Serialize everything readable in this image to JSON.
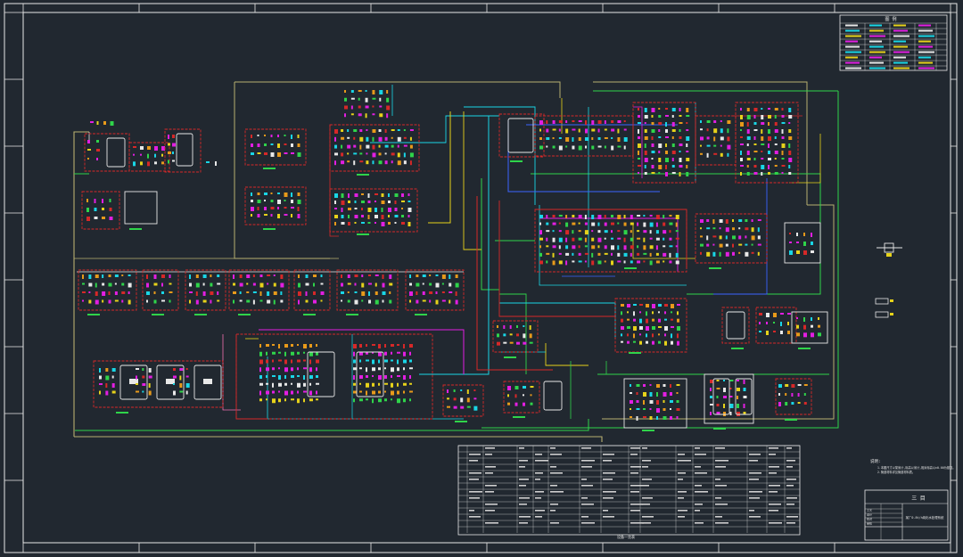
{
  "canvas": {
    "background": "#212830",
    "frame_color": "#e8e8e8"
  },
  "colors": {
    "red": "#d62828",
    "yellow": "#e6d21a",
    "green": "#2fd44a",
    "cyan": "#19d6e6",
    "blue": "#3a64ff",
    "magenta": "#e21ee2",
    "white": "#e8e8e8",
    "orange": "#e89a1a",
    "olive": "#b8b070",
    "pink": "#f06fb0",
    "purple": "#9b4dff"
  },
  "title_block": {
    "company": "三 目",
    "drawing_title": "某厂0.8t/h纯化水处理系统",
    "footer_cells": [
      "工艺",
      "设计",
      "校对",
      "审核"
    ]
  },
  "top_right_table": {
    "title": "图 例"
  },
  "notes": {
    "heading": "说明:",
    "lines": [
      "1.本图尺寸以毫米计,标高以米计,相对标高以±0.00为基准。",
      "2.管道材料详见管道材料表。"
    ]
  },
  "equipment_table": {
    "caption": "设备一览表"
  }
}
